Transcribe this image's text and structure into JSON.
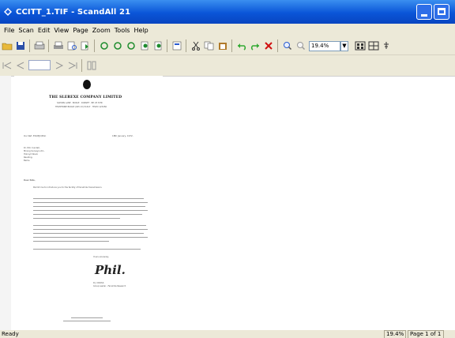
{
  "window": {
    "title": "CCITT_1.TIF - ScandAll 21"
  },
  "menu": [
    "File",
    "Scan",
    "Edit",
    "View",
    "Page",
    "Zoom",
    "Tools",
    "Help"
  ],
  "toolbar": {
    "zoom_value": "19.4%",
    "zoom_dropdown": "▼"
  },
  "document": {
    "company": "THE SLEREXE COMPANY LIMITED",
    "address1": "SAPORS LANE · BOOLE · DORSET · BH 25 8 ER",
    "address2": "TELEPHONE BOOLE (945 13) 51617 · TELEX 123456",
    "ref": "Our Ref. 350/PJC/EAC",
    "date": "18th January, 1972.",
    "recipient": [
      "Dr. P.N. Cundall,",
      "Mining Surveys Ltd.,",
      "Holroyd Road,",
      "Reading,",
      "Berks."
    ],
    "salutation": "Dear Pete,",
    "para1": "Permit me to introduce you to the facility of facsimile transmission.",
    "closing": "Yours sincerely,",
    "signature": "Phil.",
    "signer": "P.J. CROSS",
    "signer_title": "Group Leader - Facsimile Research"
  },
  "status": {
    "ready": "Ready",
    "zoom": "19.4%",
    "page": "Page 1 of 1"
  }
}
